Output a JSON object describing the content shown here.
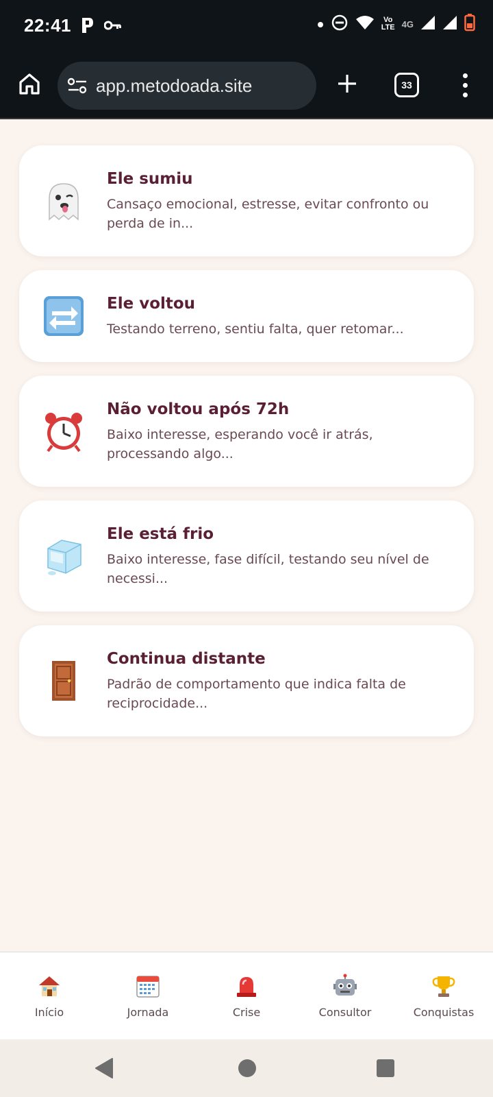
{
  "status_bar": {
    "time": "22:41",
    "network_type": "4G",
    "volte_top": "Vo",
    "volte_bottom": "LTE",
    "icons": [
      "parking-icon",
      "key-icon",
      "dot-icon",
      "dnd-icon",
      "wifi-icon",
      "signal-icon",
      "signal-icon",
      "battery-icon"
    ]
  },
  "browser": {
    "url": "app.metodoada.site",
    "tab_count": "33"
  },
  "cards": [
    {
      "icon": "ghost-icon",
      "title": "Ele sumiu",
      "description": "Cansaço emocional, estresse, evitar confronto ou perda de in..."
    },
    {
      "icon": "arrows-counterclockwise-icon",
      "title": "Ele voltou",
      "description": "Testando terreno, sentiu falta, quer retomar..."
    },
    {
      "icon": "alarm-clock-icon",
      "title": "Não voltou após 72h",
      "description": "Baixo interesse, esperando você ir atrás, processando algo..."
    },
    {
      "icon": "ice-cube-icon",
      "title": "Ele está frio",
      "description": "Baixo interesse, fase difícil, testando seu nível de necessi..."
    },
    {
      "icon": "door-icon",
      "title": "Continua distante",
      "description": "Padrão de comportamento que indica falta de reciprocidade..."
    }
  ],
  "bottom_nav": [
    {
      "icon": "house-icon",
      "label": "Início"
    },
    {
      "icon": "calendar-icon",
      "label": "Jornada"
    },
    {
      "icon": "siren-icon",
      "label": "Crise"
    },
    {
      "icon": "robot-icon",
      "label": "Consultor"
    },
    {
      "icon": "trophy-icon",
      "label": "Conquistas"
    }
  ],
  "colors": {
    "page_background": "#faf3ee",
    "card_title": "#5a1f34",
    "card_text": "#6a4a52",
    "browser_bar": "#0f1419"
  }
}
